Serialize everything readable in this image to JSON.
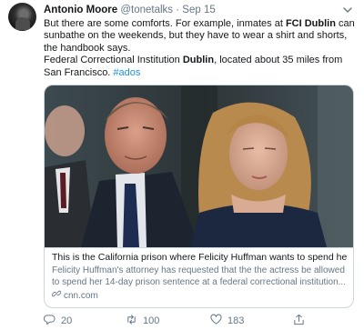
{
  "tweet": {
    "author_name": "Antonio Moore",
    "handle": "@tonetalks",
    "separator": "·",
    "date": "Sep 15",
    "text_part1": "But there are some comforts. For example, inmates at ",
    "text_bold1": "FCI Dublin",
    "text_part2": " can sunbathe on the weekends, but they have to wear a shirt and shorts, the handbook says.",
    "text_part3": "Federal Correctional Institution ",
    "text_bold2": "Dublin",
    "text_part4": ", located about 35 miles from San Francisco. ",
    "hashtag": "#ados"
  },
  "card": {
    "title": "This is the California prison where Felicity Huffman wants to spend her ...",
    "description": "Felicity Huffman's attorney has requested that the the actress be allowed to spend her 14-day prison sentence at a federal correctional institution...",
    "domain": "cnn.com"
  },
  "actions": {
    "reply_count": "20",
    "retweet_count": "100",
    "like_count": "183"
  },
  "colors": {
    "link": "#1b95e0",
    "secondary": "#657786",
    "border": "#ccd6dd"
  },
  "icons": [
    "caret-down-icon",
    "link-icon",
    "reply-icon",
    "retweet-icon",
    "like-icon",
    "share-icon"
  ]
}
